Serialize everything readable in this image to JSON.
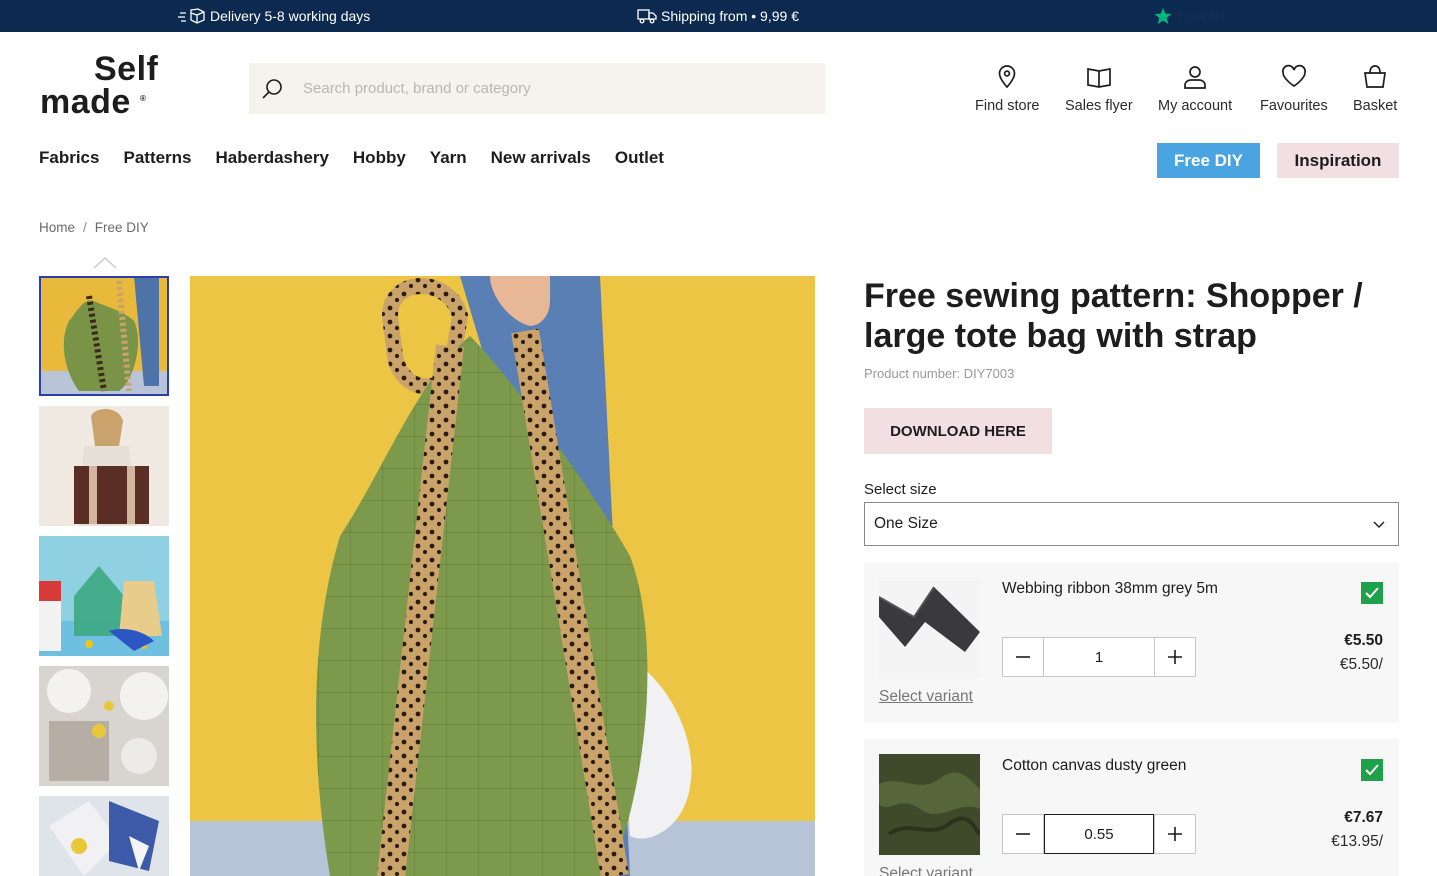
{
  "topbar": {
    "delivery": "Delivery 5-8 working days",
    "shipping": "Shipping from • 9,99 €",
    "trustpilot": "Trustpilot"
  },
  "header": {
    "logo_line1": "Self",
    "logo_line2": "made",
    "logo_reg": "®",
    "search_placeholder": "Search product, brand or category",
    "icons": [
      {
        "label": "Find store",
        "icon": "location-pin-icon"
      },
      {
        "label": "Sales flyer",
        "icon": "book-icon"
      },
      {
        "label": "My account",
        "icon": "user-icon"
      },
      {
        "label": "Favourites",
        "icon": "heart-icon"
      },
      {
        "label": "Basket",
        "icon": "basket-icon"
      }
    ]
  },
  "nav": {
    "items": [
      "Fabrics",
      "Patterns",
      "Haberdashery",
      "Hobby",
      "Yarn",
      "New arrivals",
      "Outlet"
    ],
    "free_diy": "Free DIY",
    "inspiration": "Inspiration"
  },
  "breadcrumb": {
    "home": "Home",
    "separator": "/",
    "current": "Free DIY"
  },
  "product": {
    "title": "Free sewing pattern: Shopper / large tote bag with strap",
    "product_number": "Product number: DIY7003",
    "download_label": "DOWNLOAD HERE",
    "size_label": "Select size",
    "size_value": "One Size",
    "items": [
      {
        "name": "Webbing ribbon 38mm grey 5m",
        "quantity": "1",
        "price": "€5.50",
        "unit_price": "€5.50/",
        "variant_link": "Select variant",
        "checked": true
      },
      {
        "name": "Cotton canvas dusty green",
        "quantity": "0.55",
        "price": "€7.67",
        "unit_price": "€13.95/",
        "variant_link": "Select variant",
        "checked": true
      }
    ]
  },
  "colors": {
    "topbar_bg": "#0c2a4f",
    "free_diy_bg": "#4aa4e1",
    "pink_bg": "#f2dfe1",
    "check_green": "#1fa04a",
    "search_bg": "#f6f3ec"
  }
}
